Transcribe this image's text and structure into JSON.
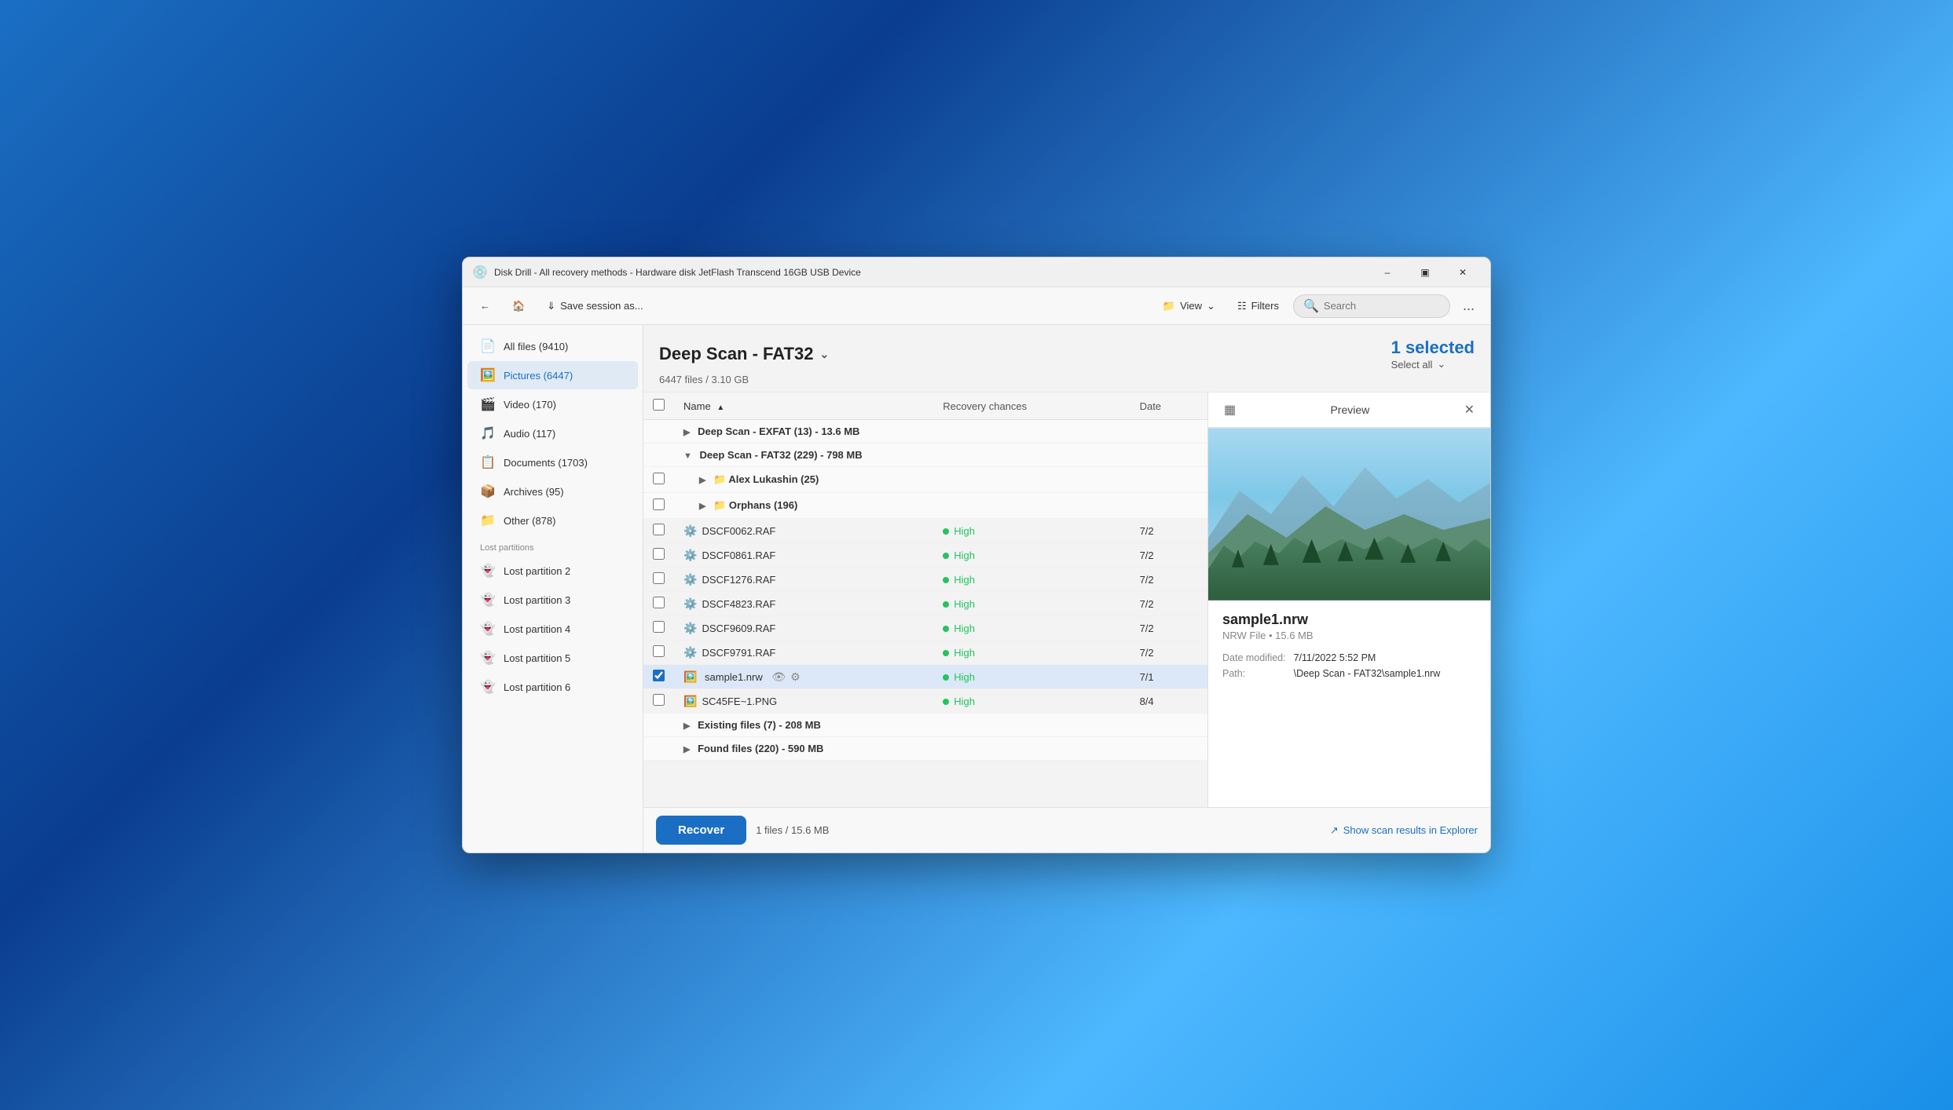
{
  "window": {
    "title": "Disk Drill - All recovery methods - Hardware disk JetFlash Transcend 16GB USB Device",
    "icon": "💿"
  },
  "toolbar": {
    "back_label": "",
    "home_label": "",
    "save_session_label": "Save session as...",
    "view_label": "View",
    "filters_label": "Filters",
    "search_placeholder": "Search",
    "more_label": "..."
  },
  "sidebar": {
    "categories": [
      {
        "id": "all-files",
        "label": "All files (9410)",
        "icon": "📄"
      },
      {
        "id": "pictures",
        "label": "Pictures (6447)",
        "icon": "🖼️"
      },
      {
        "id": "video",
        "label": "Video (170)",
        "icon": "🎬"
      },
      {
        "id": "audio",
        "label": "Audio (117)",
        "icon": "🎵"
      },
      {
        "id": "documents",
        "label": "Documents (1703)",
        "icon": "📋"
      },
      {
        "id": "archives",
        "label": "Archives (95)",
        "icon": "📦"
      },
      {
        "id": "other",
        "label": "Other (878)",
        "icon": "📁"
      }
    ],
    "section_label": "Lost partitions",
    "partitions": [
      {
        "id": "lost-2",
        "label": "Lost partition 2",
        "icon": "👻"
      },
      {
        "id": "lost-3",
        "label": "Lost partition 3",
        "icon": "👻"
      },
      {
        "id": "lost-4",
        "label": "Lost partition 4",
        "icon": "👻"
      },
      {
        "id": "lost-5",
        "label": "Lost partition 5",
        "icon": "👻"
      },
      {
        "id": "lost-6",
        "label": "Lost partition 6",
        "icon": "👻"
      }
    ]
  },
  "content": {
    "title": "Deep Scan - FAT32",
    "subtitle": "6447 files / 3.10 GB",
    "selected_count": "1 selected",
    "select_all_label": "Select all",
    "columns": {
      "name": "Name",
      "recovery_chances": "Recovery chances",
      "date": "Date"
    },
    "rows": [
      {
        "type": "group",
        "name": "Deep Scan - EXFAT (13) - 13.6 MB",
        "expanded": false,
        "checkbox": false,
        "indent": 0
      },
      {
        "type": "group",
        "name": "Deep Scan - FAT32 (229) - 798 MB",
        "expanded": true,
        "checkbox": false,
        "indent": 0
      },
      {
        "type": "group",
        "name": "Alex Lukashin (25)",
        "expanded": false,
        "checkbox": false,
        "indent": 1,
        "folder": true
      },
      {
        "type": "group",
        "name": "Orphans (196)",
        "expanded": false,
        "checkbox": false,
        "indent": 1,
        "folder": true
      },
      {
        "type": "file",
        "name": "DSCF0062.RAF",
        "recovery": "High",
        "date": "7/2",
        "checked": false,
        "selected": false
      },
      {
        "type": "file",
        "name": "DSCF0861.RAF",
        "recovery": "High",
        "date": "7/2",
        "checked": false,
        "selected": false
      },
      {
        "type": "file",
        "name": "DSCF1276.RAF",
        "recovery": "High",
        "date": "7/2",
        "checked": false,
        "selected": false
      },
      {
        "type": "file",
        "name": "DSCF4823.RAF",
        "recovery": "High",
        "date": "7/2",
        "checked": false,
        "selected": false
      },
      {
        "type": "file",
        "name": "DSCF9609.RAF",
        "recovery": "High",
        "date": "7/2",
        "checked": false,
        "selected": false
      },
      {
        "type": "file",
        "name": "DSCF9791.RAF",
        "recovery": "High",
        "date": "7/2",
        "checked": false,
        "selected": false
      },
      {
        "type": "file",
        "name": "sample1.nrw",
        "recovery": "High",
        "date": "7/1",
        "checked": true,
        "selected": true,
        "has_actions": true
      },
      {
        "type": "file",
        "name": "SC45FE~1.PNG",
        "recovery": "High",
        "date": "8/4",
        "checked": false,
        "selected": false
      },
      {
        "type": "group",
        "name": "Existing files (7) - 208 MB",
        "expanded": false,
        "checkbox": false,
        "indent": 0
      },
      {
        "type": "group",
        "name": "Found files (220) - 590 MB",
        "expanded": false,
        "checkbox": false,
        "indent": 0
      }
    ]
  },
  "preview": {
    "title": "Preview",
    "filename": "sample1.nrw",
    "filetype": "NRW File • 15.6 MB",
    "date_modified_label": "Date modified:",
    "date_modified_value": "7/11/2022 5:52 PM",
    "path_label": "Path:",
    "path_value": "\\Deep Scan - FAT32\\sample1.nrw"
  },
  "bottom_bar": {
    "recover_label": "Recover",
    "files_info": "1 files / 15.6 MB",
    "show_explorer_label": "Show scan results in Explorer"
  }
}
